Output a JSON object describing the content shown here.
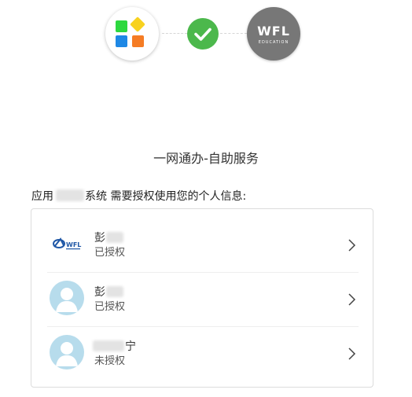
{
  "header": {
    "org_logo_main": "WFL",
    "org_logo_sub": "EDUCATION"
  },
  "service_title": "一网通办-自助服务",
  "consent": {
    "prefix": "应用",
    "suffix": "系统 需要授权使用您的个人信息:"
  },
  "accounts": [
    {
      "name": "彭",
      "status": "已授权",
      "avatar": "wfl-logo-icon"
    },
    {
      "name": "彭",
      "status": "已授权",
      "avatar": "user-avatar-icon"
    },
    {
      "name": "宁",
      "status": "未授权",
      "avatar": "user-avatar-icon"
    }
  ],
  "colors": {
    "check_green": "#4cb84c",
    "org_logo_bg": "#777777",
    "avatar_bg": "#b7dcec",
    "border": "#dcdcdc"
  }
}
